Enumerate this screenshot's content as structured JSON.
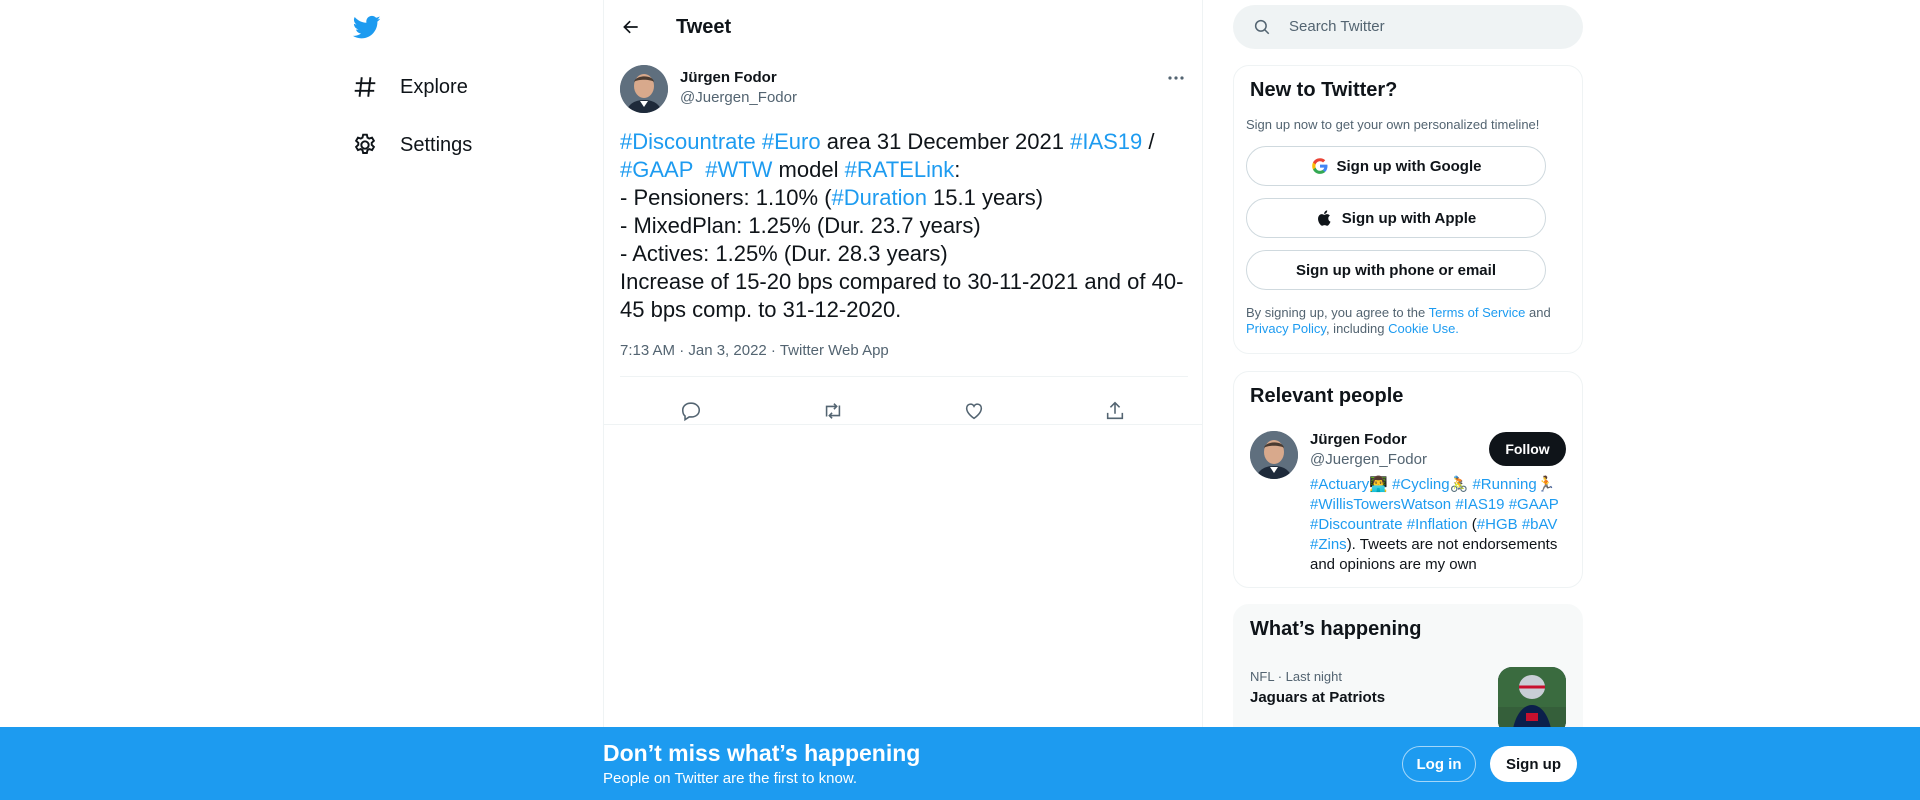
{
  "nav": {
    "items": [
      {
        "label": "Explore",
        "icon": "hashtag-icon"
      },
      {
        "label": "Settings",
        "icon": "gear-icon"
      }
    ]
  },
  "header": {
    "title": "Tweet"
  },
  "tweet": {
    "author_name": "Jürgen Fodor",
    "author_handle": "@Juergen_Fodor",
    "line1": [
      "#Discountrate",
      " ",
      "#Euro",
      " area 31 December 2021 ",
      "#IAS19",
      " /"
    ],
    "line2": [
      "#GAAP",
      "  ",
      "#WTW",
      " model ",
      "#RATELink",
      ":"
    ],
    "line3": [
      "- Pensioners: 1.10% (",
      "#Duration",
      " 15.1 years)"
    ],
    "line4": "- MixedPlan: 1.25% (Dur. 23.7 years)",
    "line5": "- Actives: 1.25% (Dur. 28.3 years)",
    "line6": "Increase of 15-20 bps compared to 30-11-2021 and of 40-45 bps comp. to 31-12-2020.",
    "meta": "7:13 AM · Jan 3, 2022 · Twitter Web App"
  },
  "search": {
    "placeholder": "Search Twitter"
  },
  "new_to_twitter": {
    "title": "New to Twitter?",
    "subtitle": "Sign up now to get your own personalized timeline!",
    "google_label": "Sign up with Google",
    "apple_label": "Sign up with Apple",
    "phone_label": "Sign up with phone or email",
    "legal_prefix": "By signing up, you agree to the ",
    "terms": "Terms of Service",
    "and": " and",
    "privacy": "Privacy Policy",
    "including": ", including ",
    "cookie": "Cookie Use."
  },
  "relevant_people": {
    "title": "Relevant people",
    "name": "Jürgen Fodor",
    "handle": "@Juergen_Fodor",
    "follow_label": "Follow",
    "bio_links_1": [
      "#Actuary",
      "👨‍💻",
      " ",
      "#Cycling",
      "🚴",
      " ",
      "#Running",
      "🏃"
    ],
    "bio_links_2": [
      "#WillisTowersWatson",
      " ",
      "#IAS19",
      " ",
      "#GAAP"
    ],
    "bio_links_3": [
      "#Discountrate",
      " ",
      "#Inflation",
      " (",
      "#HGB",
      " ",
      "#bAV"
    ],
    "bio_links_4": [
      "#Zins",
      "). Tweets are not endorsements and opinions are my own"
    ]
  },
  "whats_happening": {
    "title": "What’s happening",
    "trend_meta": "NFL · Last night",
    "trend_title": "Jaguars at Patriots"
  },
  "banner": {
    "title": "Don’t miss what’s happening",
    "subtitle": "People on Twitter are the first to know.",
    "login_label": "Log in",
    "signup_label": "Sign up"
  },
  "colors": {
    "accent": "#1d9bf0",
    "text": "#0f1419",
    "muted": "#536471",
    "border": "#eff3f4"
  }
}
